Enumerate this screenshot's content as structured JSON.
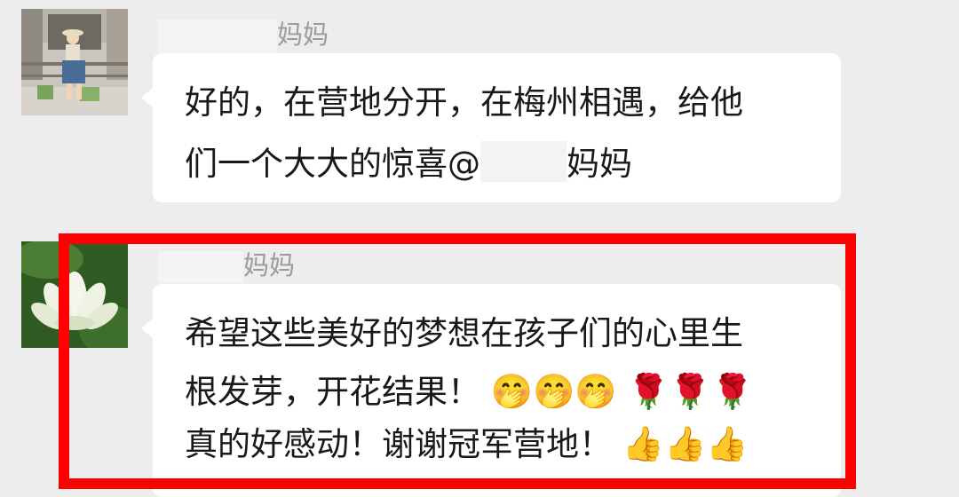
{
  "messages": [
    {
      "sender_suffix": "妈妈",
      "avatar": "girl-photo-avatar",
      "line1": "好的，在营地分开，在梅州相遇，给他",
      "line2_before": "们一个大大的惊喜@",
      "line2_after": "妈妈"
    },
    {
      "sender_suffix": "妈妈",
      "avatar": "lotus-flower-avatar",
      "line1": "希望这些美好的梦想在孩子们的心里生",
      "line2": "根发芽，开花结果！",
      "line2_emojis": [
        "🤭",
        "🤭",
        "🤭",
        "🌹",
        "🌹",
        "🌹"
      ],
      "line3": "真的好感动！谢谢冠军营地！",
      "line3_emojis": [
        "👍",
        "👍",
        "👍"
      ]
    }
  ],
  "highlight": {
    "color": "#ff0000",
    "target": "message-2"
  }
}
